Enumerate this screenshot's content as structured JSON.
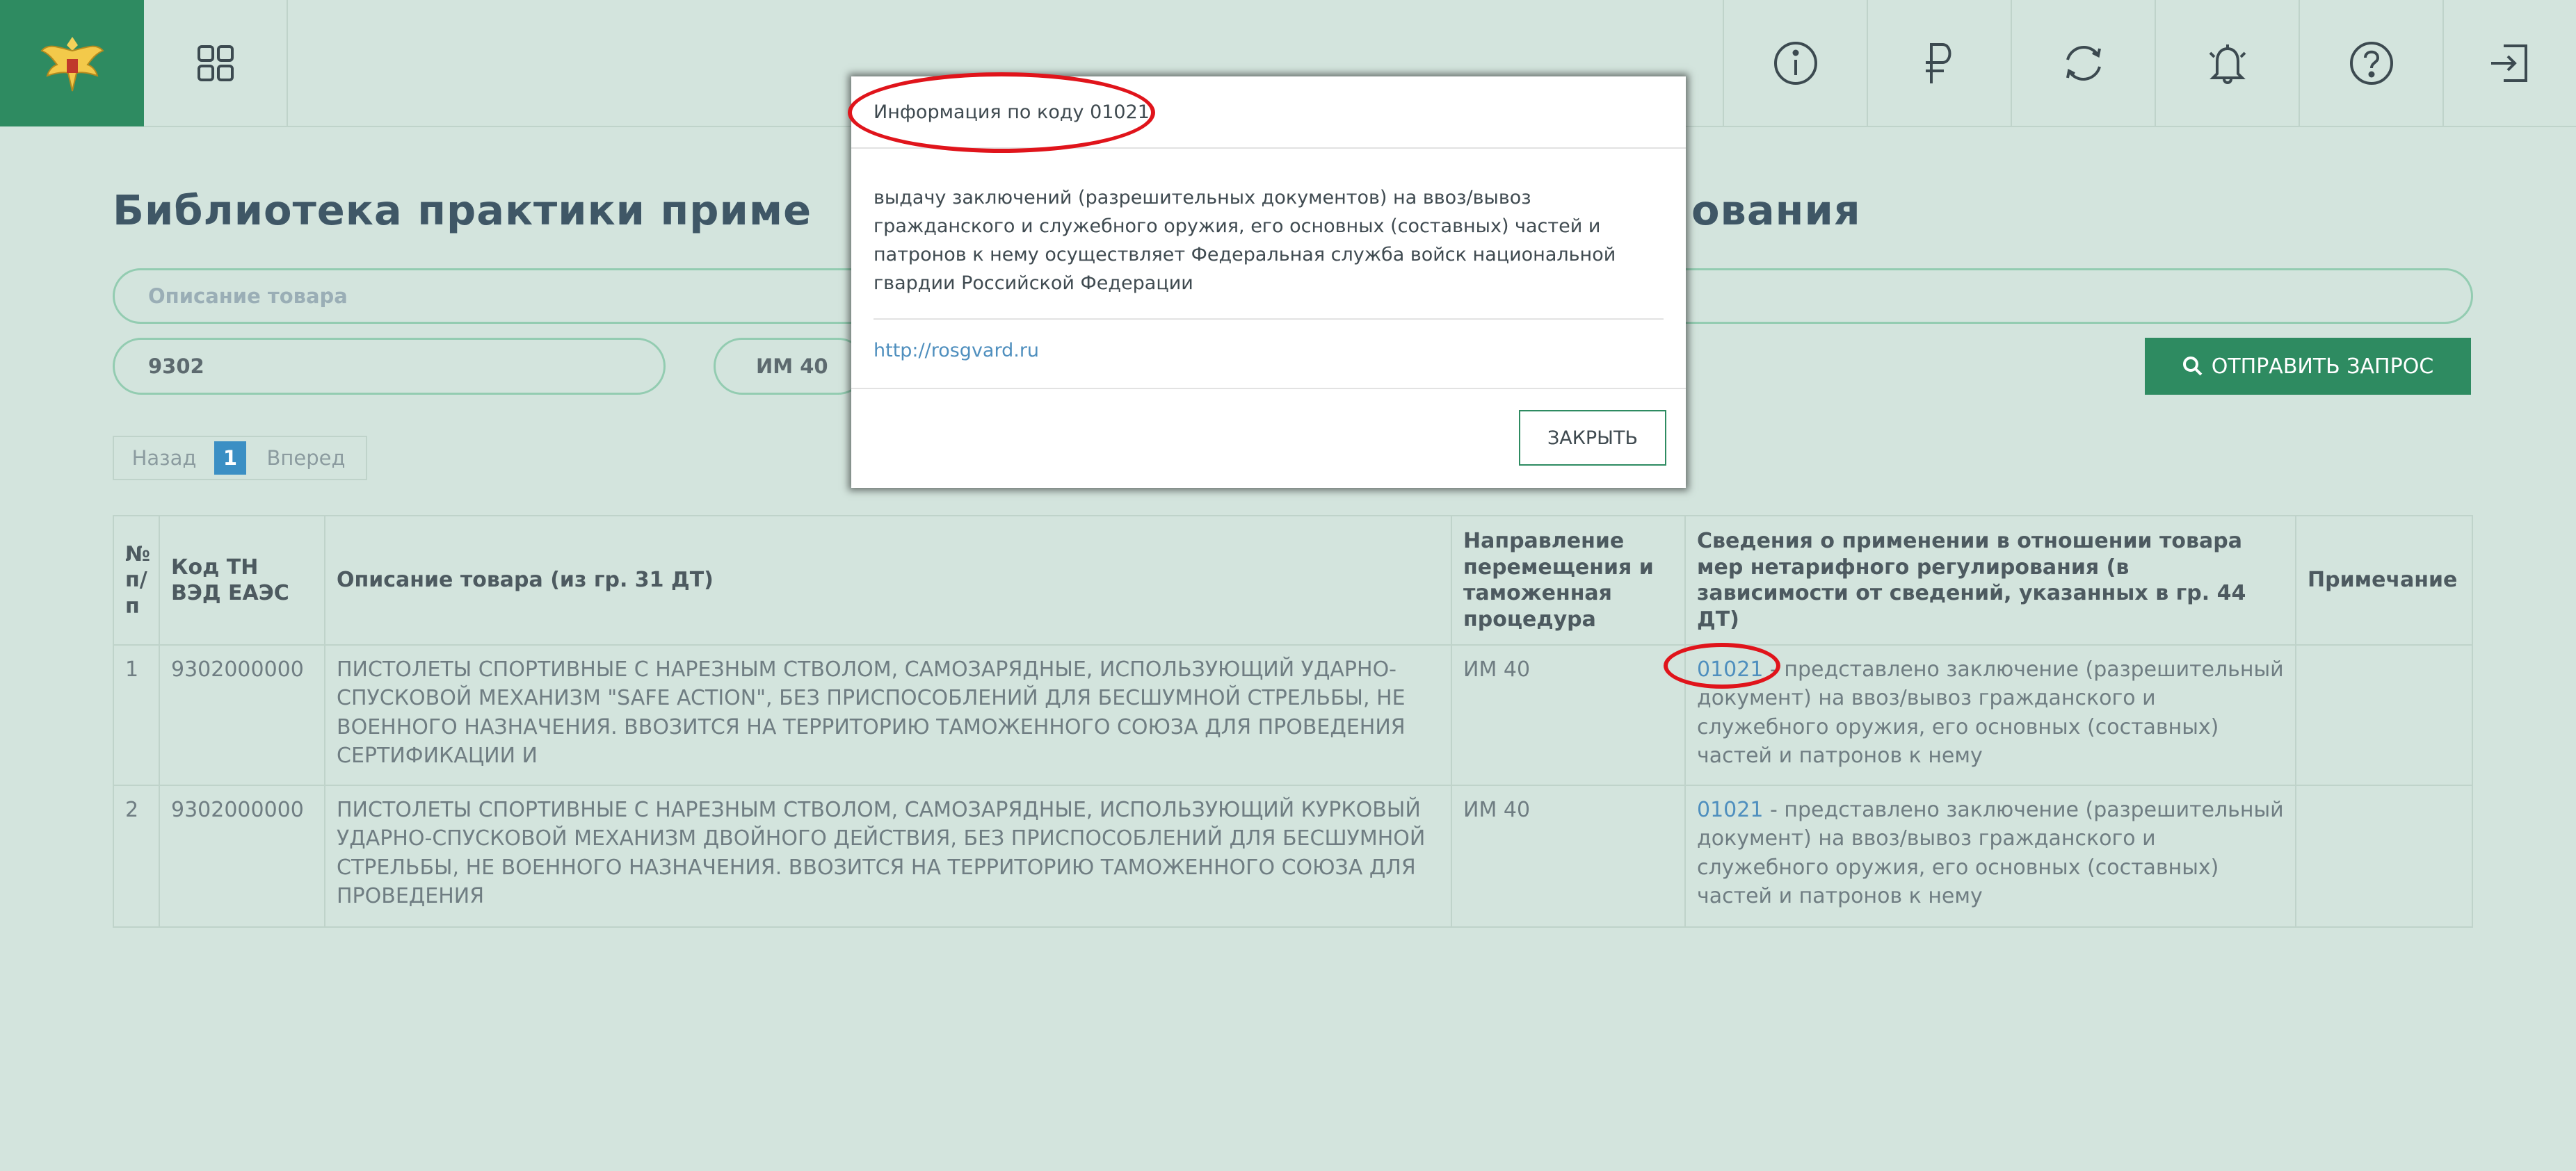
{
  "topbar": {
    "icons": [
      "emblem-logo",
      "grid-icon",
      "info-icon",
      "ruble-icon",
      "refresh-icon",
      "bell-icon",
      "help-icon",
      "logout-icon"
    ]
  },
  "page": {
    "title_start": "Библиотека практики приме",
    "title_end": "ования"
  },
  "form": {
    "description_placeholder": "Описание товара",
    "code_value": "9302",
    "procedure_value": "ИМ 40",
    "send_label": "ОТПРАВИТЬ ЗАПРОС"
  },
  "pager": {
    "prev": "Назад",
    "current": "1",
    "next": "Вперед"
  },
  "table": {
    "headers": {
      "num": "№ п/п",
      "code": "Код ТН ВЭД ЕАЭС",
      "description": "Описание товара (из гр. 31 ДТ)",
      "direction": "Направление перемещения и таможенная процедура",
      "info": "Сведения о применении в отношении товара мер нетарифного регулирования (в зависимости от сведений, указанных в гр. 44 ДТ)",
      "note": "Примечание"
    },
    "rows": [
      {
        "num": "1",
        "code": "9302000000",
        "description": "ПИСТОЛЕТЫ СПОРТИВНЫЕ С НАРЕЗНЫМ СТВОЛОМ, САМОЗАРЯДНЫЕ, ИСПОЛЬЗУЮЩИЙ УДАРНО-СПУСКОВОЙ МЕХАНИЗМ \"SAFE ACTION\", БЕЗ ПРИСПОСОБЛЕНИЙ ДЛЯ БЕСШУМНОЙ СТРЕЛЬБЫ, НЕ ВОЕННОГО НАЗНАЧЕНИЯ. ВВОЗИТСЯ НА ТЕРРИТОРИЮ ТАМОЖЕННОГО СОЮЗА ДЛЯ ПРОВЕДЕНИЯ СЕРТИФИКАЦИИ И",
        "direction": "ИМ 40",
        "info_code": "01021",
        "info_text": " - представлено заключение (разрешительный документ) на ввоз/вывоз гражданского и служебного оружия, его основных (составных) частей и патронов к нему",
        "note": ""
      },
      {
        "num": "2",
        "code": "9302000000",
        "description": "ПИСТОЛЕТЫ СПОРТИВНЫЕ С НАРЕЗНЫМ СТВОЛОМ, САМОЗАРЯДНЫЕ, ИСПОЛЬЗУЮЩИЙ КУРКОВЫЙ УДАРНО-СПУСКОВОЙ МЕХАНИЗМ ДВОЙНОГО ДЕЙСТВИЯ, БЕЗ ПРИСПОСОБЛЕНИЙ ДЛЯ БЕСШУМНОЙ СТРЕЛЬБЫ, НЕ ВОЕННОГО НАЗНАЧЕНИЯ. ВВОЗИТСЯ НА ТЕРРИТОРИЮ ТАМОЖЕННОГО СОЮЗА ДЛЯ ПРОВЕДЕНИЯ",
        "direction": "ИМ 40",
        "info_code": "01021",
        "info_text": " - представлено заключение (разрешительный документ) на ввоз/вывоз гражданского и служебного оружия, его основных (составных) частей и патронов к нему",
        "note": ""
      }
    ]
  },
  "modal": {
    "title": "Информация по коду 01021",
    "body": "выдачу заключений (разрешительных документов) на ввоз/вывоз гражданского и служебного оружия, его основных (составных) частей и патронов к нему осуществляет Федеральная служба войск национальной гвардии Российской Федерации",
    "link": "http://rosgvard.ru",
    "close_label": "ЗАКРЫТЬ"
  },
  "colors": {
    "page_bg": "#d3e4dd",
    "brand_green": "#2e8b61",
    "link_blue": "#4f8fbe",
    "annotation_red": "#e0141b"
  }
}
